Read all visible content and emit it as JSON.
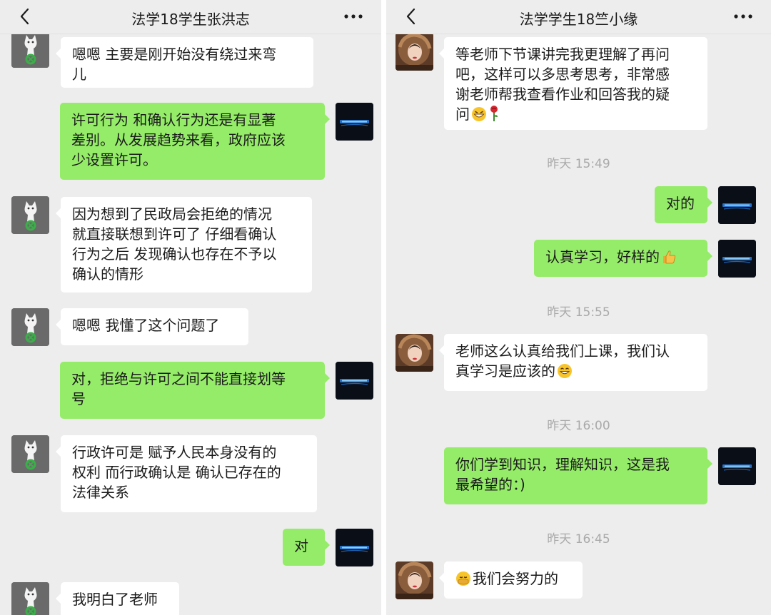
{
  "left_chat": {
    "title": "法学18学生张洪志",
    "messages": [
      {
        "lines": [
          "嗯嗯 主要是刚开始没有绕过来弯",
          "儿"
        ]
      },
      {
        "lines": [
          "许可行为 和确认行为还是有显著",
          "差别。从发展趋势来看，政府应该",
          "少设置许可。"
        ]
      },
      {
        "lines": [
          "因为想到了民政局会拒绝的情况",
          "就直接联想到许可了 仔细看确认",
          "行为之后 发现确认也存在不予以",
          "确认的情形"
        ]
      },
      {
        "lines": [
          "嗯嗯 我懂了这个问题了"
        ]
      },
      {
        "lines": [
          "对，拒绝与许可之间不能直接划等",
          "号"
        ]
      },
      {
        "lines": [
          "行政许可是 赋予人民本身没有的",
          "权利 而行政确认是 确认已存在的",
          "法律关系"
        ]
      },
      {
        "lines": [
          "对"
        ]
      },
      {
        "lines": [
          "我明白了老师"
        ]
      }
    ]
  },
  "right_chat": {
    "title": "法学学生18竺小缘",
    "messages": [
      {
        "lines": [
          "等老师下节课讲完我更理解了再问",
          "吧，这样可以多思考思考，非常感",
          "谢老师帮我查看作业和回答我的疑",
          "问"
        ],
        "emoji": [
          "grin",
          "rose"
        ]
      },
      {
        "lines": [
          "对的"
        ]
      },
      {
        "lines": [
          "认真学习，好样的"
        ],
        "emoji": [
          "thumbs-up"
        ]
      },
      {
        "lines": [
          "老师这么认真给我们上课，我们认",
          "真学习是应该的"
        ],
        "emoji": [
          "smile"
        ]
      },
      {
        "lines": [
          "你们学到知识，理解知识，这是我",
          "最希望的：)"
        ]
      },
      {
        "lines": [
          "我们会努力的"
        ],
        "emoji_before": "facepalm"
      }
    ],
    "timestamps": [
      "昨天 15:49",
      "昨天 15:55",
      "昨天 16:00",
      "昨天 16:45"
    ]
  },
  "colors": {
    "chat_background": "#ededed",
    "outgoing_bubble": "#95ec69",
    "incoming_bubble": "#ffffff",
    "timestamp_text": "#a9a9a9"
  },
  "icons": {
    "back": "chevron-left-icon",
    "more": "more-dots-icon",
    "avatar_left_contact": "cat-avatar",
    "avatar_self": "night-logo-avatar",
    "avatar_right_contact": "fur-hood-avatar"
  }
}
